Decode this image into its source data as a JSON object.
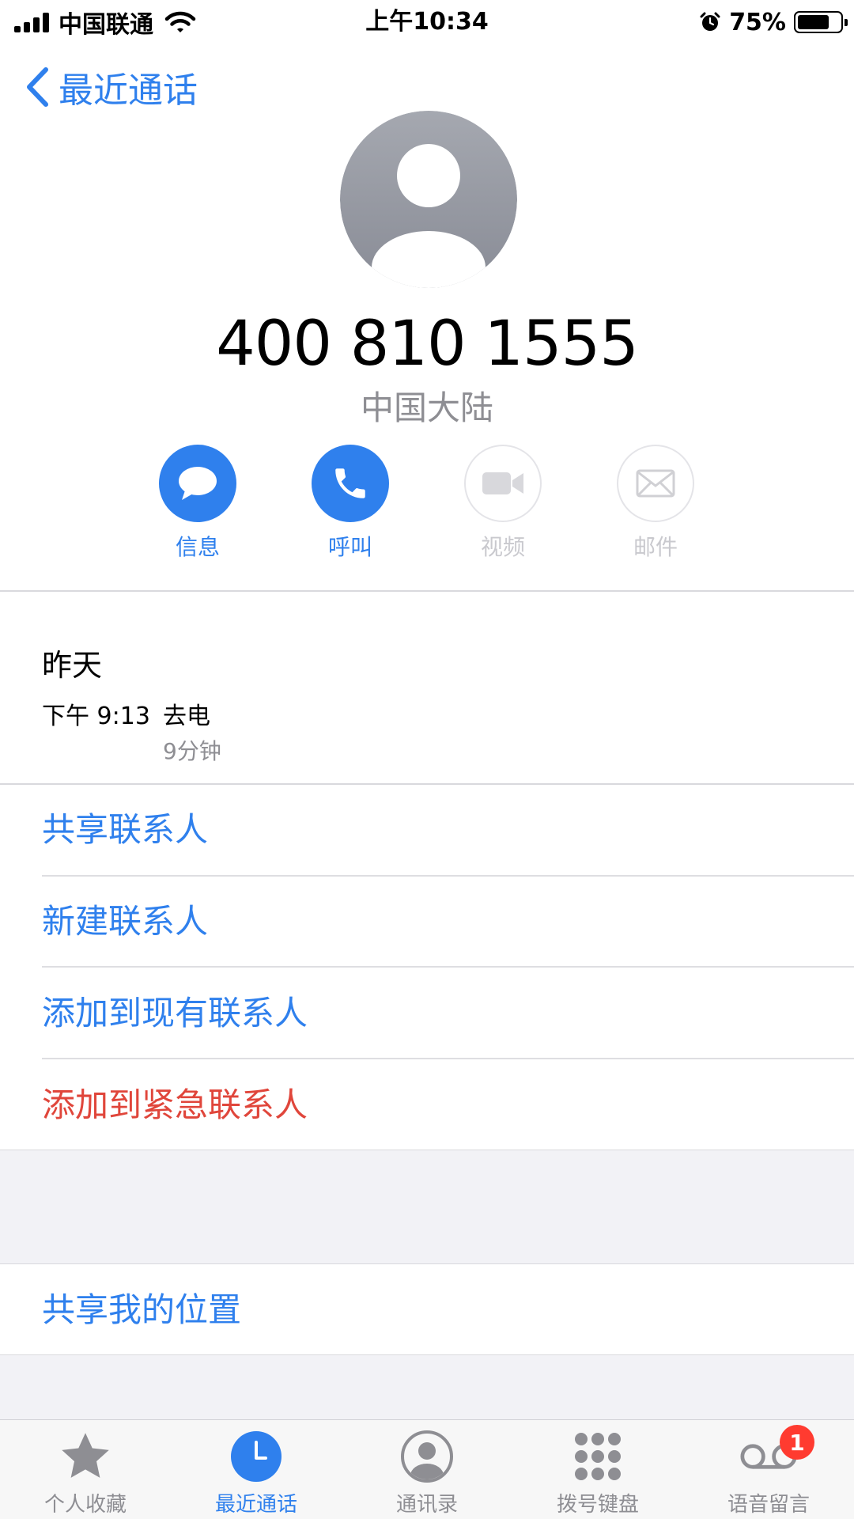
{
  "status_bar": {
    "carrier": "中国联通",
    "time": "上午10:34",
    "battery_percent": "75%",
    "battery_level": 0.75
  },
  "nav": {
    "back_label": "最近通话"
  },
  "contact": {
    "phone_number": "400 810 1555",
    "location": "中国大陆"
  },
  "actions": [
    {
      "label": "信息",
      "icon": "message-icon",
      "enabled": true
    },
    {
      "label": "呼叫",
      "icon": "phone-icon",
      "enabled": true
    },
    {
      "label": "视频",
      "icon": "video-icon",
      "enabled": false
    },
    {
      "label": "邮件",
      "icon": "mail-icon",
      "enabled": false
    }
  ],
  "call_log": {
    "date": "昨天",
    "time": "下午 9:13",
    "type": "去电",
    "duration": "9分钟"
  },
  "options": {
    "share_contact": "共享联系人",
    "new_contact": "新建联系人",
    "add_existing": "添加到现有联系人",
    "add_emergency": "添加到紧急联系人",
    "share_location": "共享我的位置"
  },
  "tabs": [
    {
      "label": "个人收藏",
      "icon": "star-icon",
      "active": false
    },
    {
      "label": "最近通话",
      "icon": "clock-icon",
      "active": true
    },
    {
      "label": "通讯录",
      "icon": "contacts-icon",
      "active": false
    },
    {
      "label": "拨号键盘",
      "icon": "keypad-icon",
      "active": false
    },
    {
      "label": "语音留言",
      "icon": "voicemail-icon",
      "active": false,
      "badge": "1"
    }
  ],
  "colors": {
    "accent": "#2f80ed",
    "destructive": "#e0463b",
    "secondary_text": "#8e8e93",
    "disabled": "#c9c9ce",
    "grouped_background": "#f2f2f6"
  }
}
